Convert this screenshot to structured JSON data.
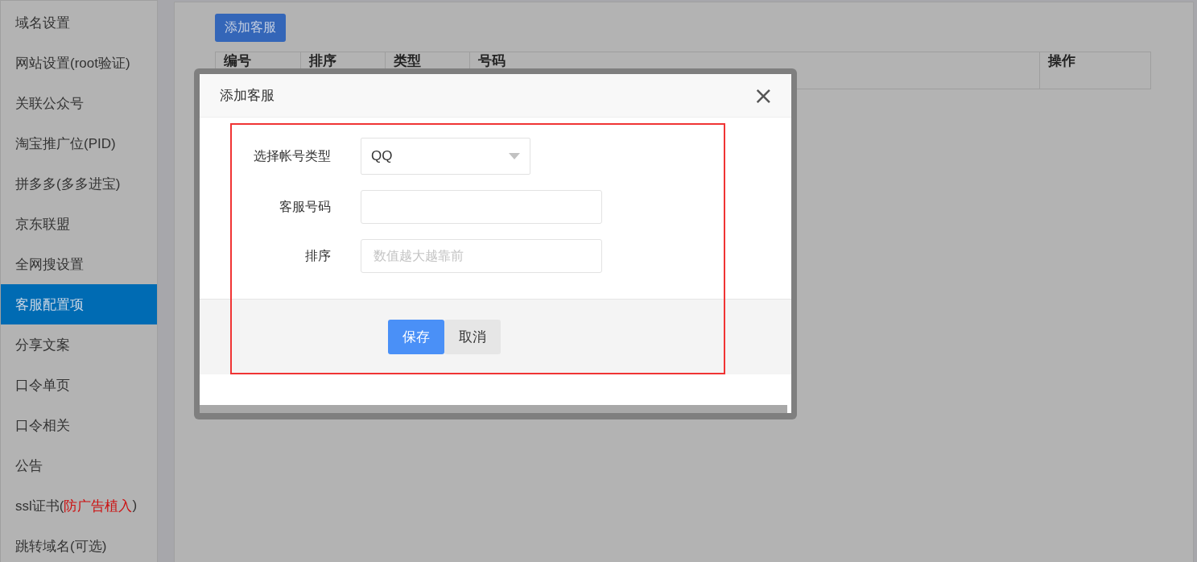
{
  "sidebar": {
    "items": [
      {
        "parts": [
          {
            "text": "域名设置",
            "alert": false
          }
        ],
        "selected": false
      },
      {
        "parts": [
          {
            "text": "网站设置(root验证)",
            "alert": false
          }
        ],
        "selected": false
      },
      {
        "parts": [
          {
            "text": "关联公众号",
            "alert": false
          }
        ],
        "selected": false
      },
      {
        "parts": [
          {
            "text": "淘宝推广位(PID)",
            "alert": false
          }
        ],
        "selected": false
      },
      {
        "parts": [
          {
            "text": "拼多多(多多进宝)",
            "alert": false
          }
        ],
        "selected": false
      },
      {
        "parts": [
          {
            "text": "京东联盟",
            "alert": false
          }
        ],
        "selected": false
      },
      {
        "parts": [
          {
            "text": "全网搜设置",
            "alert": false
          }
        ],
        "selected": false
      },
      {
        "parts": [
          {
            "text": "客服配置项",
            "alert": false
          }
        ],
        "selected": true
      },
      {
        "parts": [
          {
            "text": "分享文案",
            "alert": false
          }
        ],
        "selected": false
      },
      {
        "parts": [
          {
            "text": "口令单页",
            "alert": false
          }
        ],
        "selected": false
      },
      {
        "parts": [
          {
            "text": "口令相关",
            "alert": false
          }
        ],
        "selected": false
      },
      {
        "parts": [
          {
            "text": "公告",
            "alert": false
          }
        ],
        "selected": false
      },
      {
        "parts": [
          {
            "text": "ssl证书(",
            "alert": false
          },
          {
            "text": "防广告植入",
            "alert": true
          },
          {
            "text": ")",
            "alert": false
          }
        ],
        "selected": false
      },
      {
        "parts": [
          {
            "text": "跳转域名(可选)",
            "alert": false
          }
        ],
        "selected": false
      }
    ]
  },
  "add_button": "添加客服",
  "table": {
    "columns": [
      "编号",
      "排序",
      "类型",
      "号码",
      "操作"
    ]
  },
  "dialog": {
    "title": "添加客服",
    "close": "×",
    "fields": [
      {
        "kind": "select",
        "label": "选择帐号类型",
        "value": "QQ"
      },
      {
        "kind": "input",
        "label": "客服号码"
      },
      {
        "kind": "input",
        "label": "排序",
        "placeholder": "数值越大越靠前"
      }
    ],
    "buttons": [
      {
        "label": "保存",
        "primary": true
      },
      {
        "label": "取消",
        "primary": false
      }
    ]
  }
}
